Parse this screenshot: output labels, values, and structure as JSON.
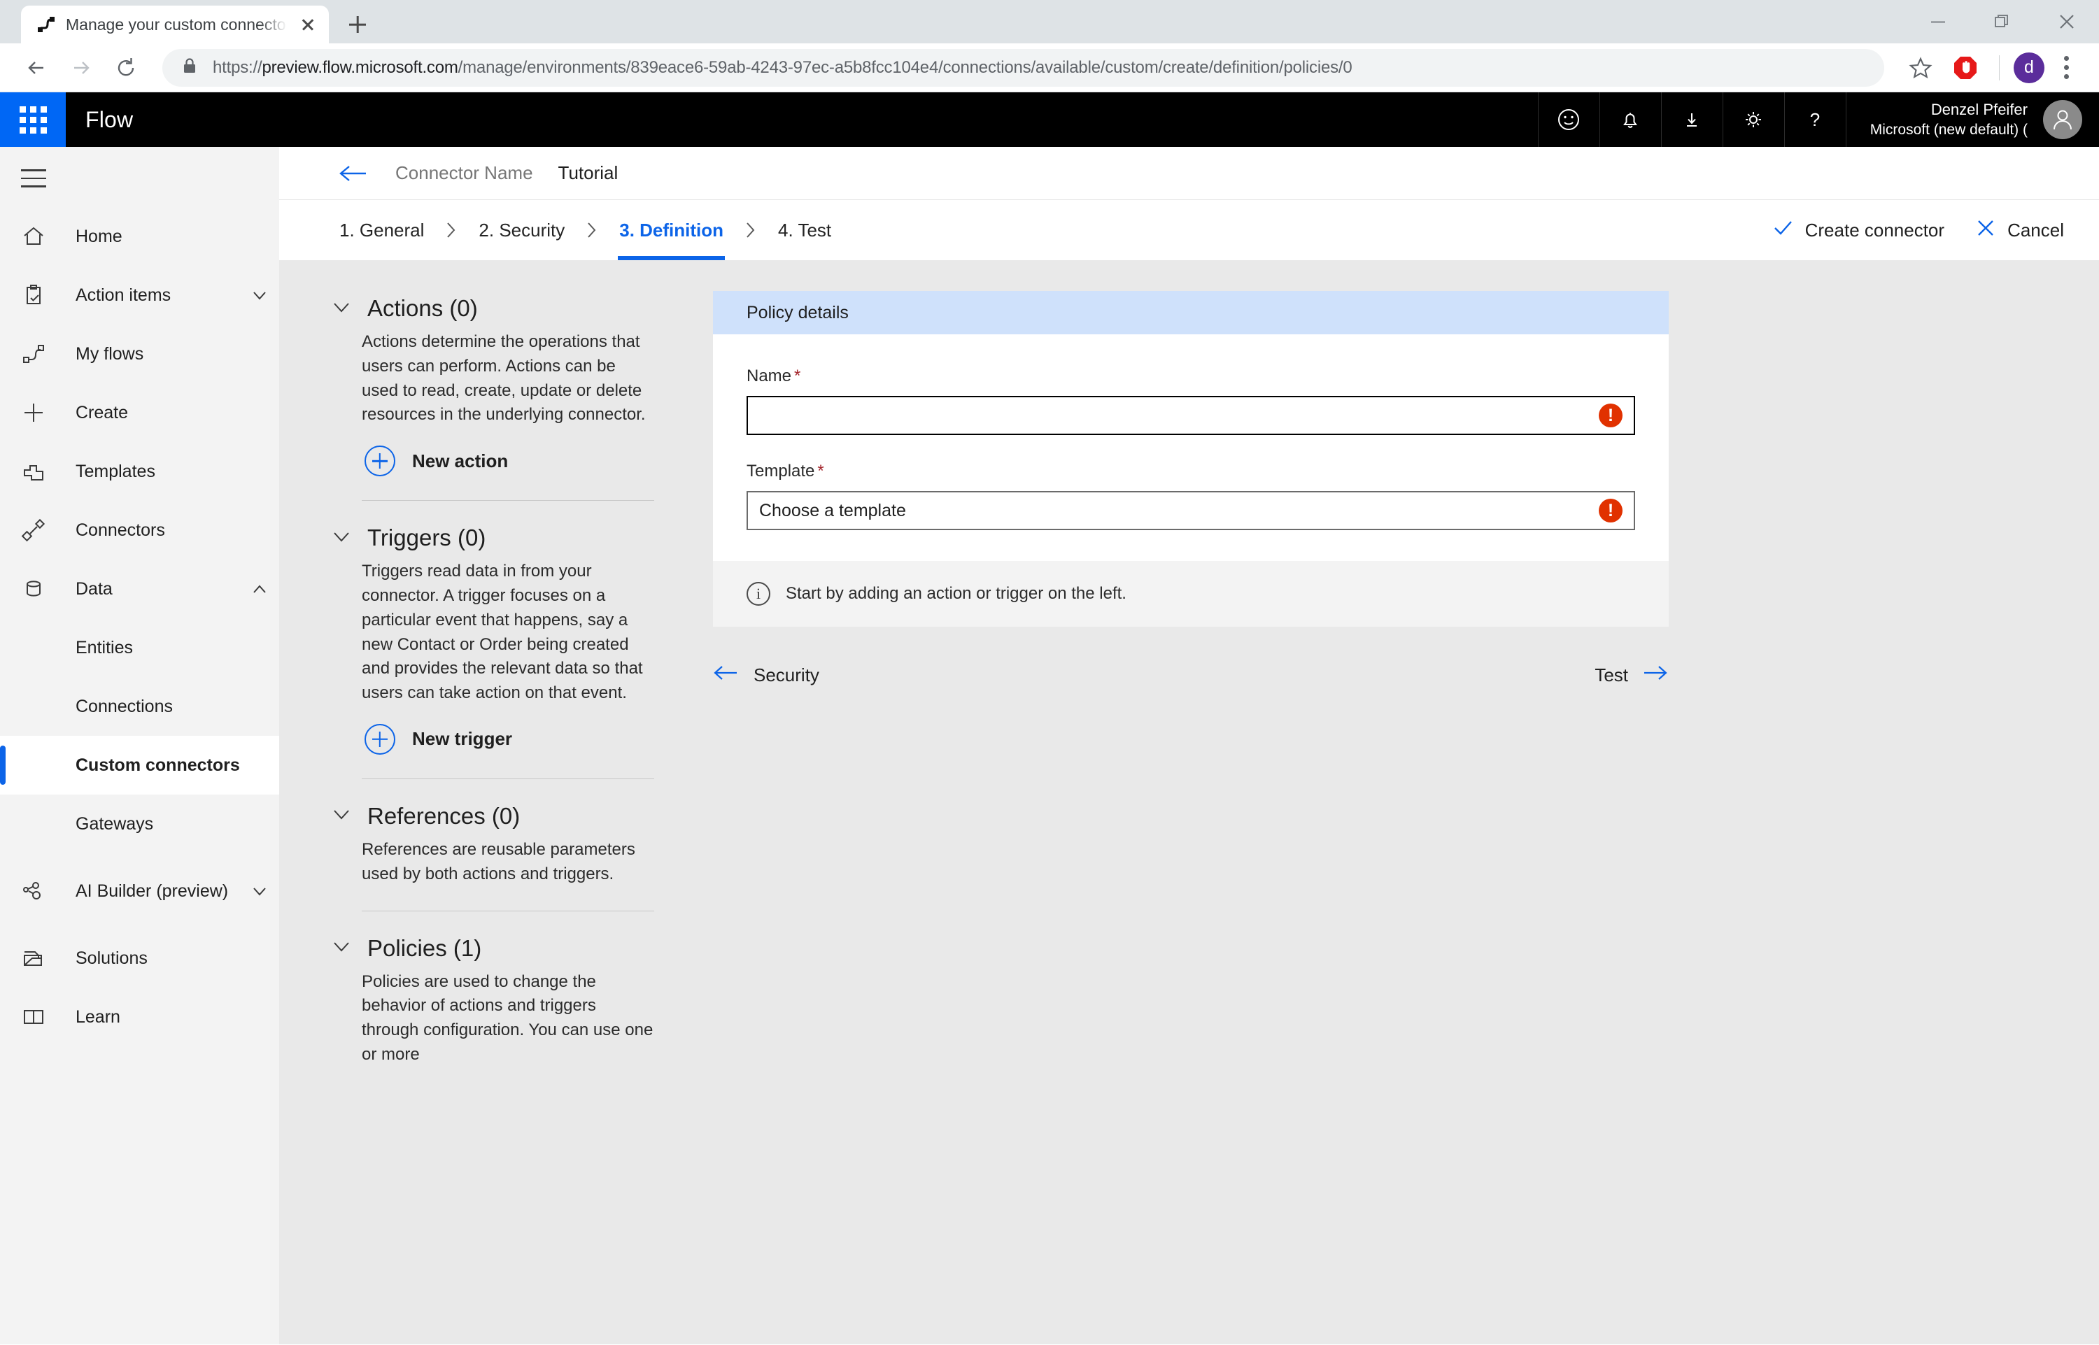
{
  "browser": {
    "tab_title": "Manage your custom connectors",
    "url_scheme": "https://",
    "url_host": "preview.flow.microsoft.com",
    "url_path": "/manage/environments/839eace6-59ab-4243-97ec-a5b8fcc104e4/connections/available/custom/create/definition/policies/0",
    "profile_initial": "d"
  },
  "appheader": {
    "title": "Flow",
    "user_name": "Denzel Pfeifer",
    "user_org": "Microsoft (new default) ("
  },
  "sidebar": {
    "items": [
      {
        "label": "Home",
        "icon": "home-icon",
        "sub": false,
        "chevron": ""
      },
      {
        "label": "Action items",
        "icon": "clipboard-check-icon",
        "sub": false,
        "chevron": "down"
      },
      {
        "label": "My flows",
        "icon": "flow-icon",
        "sub": false,
        "chevron": ""
      },
      {
        "label": "Create",
        "icon": "plus-icon",
        "sub": false,
        "chevron": ""
      },
      {
        "label": "Templates",
        "icon": "templates-icon",
        "sub": false,
        "chevron": ""
      },
      {
        "label": "Connectors",
        "icon": "plug-icon",
        "sub": false,
        "chevron": ""
      },
      {
        "label": "Data",
        "icon": "database-icon",
        "sub": false,
        "chevron": "up"
      },
      {
        "label": "Entities",
        "icon": "",
        "sub": true,
        "chevron": ""
      },
      {
        "label": "Connections",
        "icon": "",
        "sub": true,
        "chevron": ""
      },
      {
        "label": "Custom connectors",
        "icon": "",
        "sub": true,
        "chevron": "",
        "selected": true
      },
      {
        "label": "Gateways",
        "icon": "",
        "sub": true,
        "chevron": ""
      },
      {
        "label": "AI Builder (preview)",
        "icon": "ai-builder-icon",
        "sub": false,
        "chevron": "down",
        "tall": true
      },
      {
        "label": "Solutions",
        "icon": "solutions-icon",
        "sub": false,
        "chevron": ""
      },
      {
        "label": "Learn",
        "icon": "book-icon",
        "sub": false,
        "chevron": ""
      }
    ]
  },
  "breadcrumb": {
    "connector_name": "Connector Name",
    "current": "Tutorial"
  },
  "wizard": {
    "steps": [
      {
        "label": "1. General",
        "active": false
      },
      {
        "label": "2. Security",
        "active": false
      },
      {
        "label": "3. Definition",
        "active": true
      },
      {
        "label": "4. Test",
        "active": false
      }
    ],
    "separator": "❯",
    "create_label": "Create connector",
    "cancel_label": "Cancel"
  },
  "definition_sections": [
    {
      "title": "Actions (0)",
      "body": "Actions determine the operations that users can perform. Actions can be used to read, create, update or delete resources in the underlying connector.",
      "button": "New action"
    },
    {
      "title": "Triggers (0)",
      "body": "Triggers read data in from your connector. A trigger focuses on a particular event that happens, say a new Contact or Order being created and provides the relevant data so that users can take action on that event.",
      "button": "New trigger"
    },
    {
      "title": "References (0)",
      "body": "References are reusable parameters used by both actions and triggers.",
      "button": ""
    },
    {
      "title": "Policies (1)",
      "body": "Policies are used to change the behavior of actions and triggers through configuration. You can use one or more",
      "button": ""
    }
  ],
  "policy_details": {
    "card_title": "Policy details",
    "name_label": "Name",
    "name_value": "",
    "name_required": "*",
    "template_label": "Template",
    "template_value": "Choose a template",
    "template_required": "*",
    "note": "Start by adding an action or trigger on the left.",
    "error_glyph": "!"
  },
  "pagenav": {
    "prev_label": "Security",
    "next_label": "Test"
  }
}
